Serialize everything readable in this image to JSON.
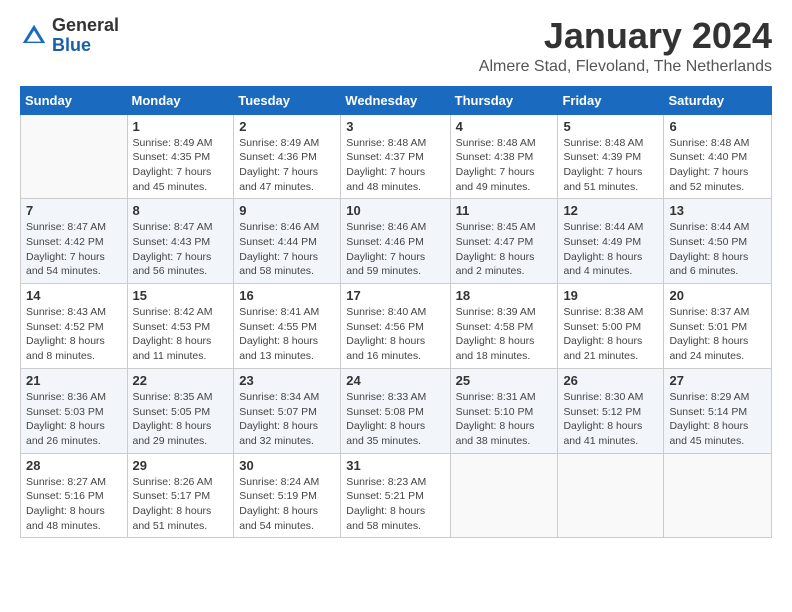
{
  "header": {
    "logo_general": "General",
    "logo_blue": "Blue",
    "month": "January 2024",
    "location": "Almere Stad, Flevoland, The Netherlands"
  },
  "days_of_week": [
    "Sunday",
    "Monday",
    "Tuesday",
    "Wednesday",
    "Thursday",
    "Friday",
    "Saturday"
  ],
  "weeks": [
    [
      {
        "day": "",
        "info": ""
      },
      {
        "day": "1",
        "info": "Sunrise: 8:49 AM\nSunset: 4:35 PM\nDaylight: 7 hours\nand 45 minutes."
      },
      {
        "day": "2",
        "info": "Sunrise: 8:49 AM\nSunset: 4:36 PM\nDaylight: 7 hours\nand 47 minutes."
      },
      {
        "day": "3",
        "info": "Sunrise: 8:48 AM\nSunset: 4:37 PM\nDaylight: 7 hours\nand 48 minutes."
      },
      {
        "day": "4",
        "info": "Sunrise: 8:48 AM\nSunset: 4:38 PM\nDaylight: 7 hours\nand 49 minutes."
      },
      {
        "day": "5",
        "info": "Sunrise: 8:48 AM\nSunset: 4:39 PM\nDaylight: 7 hours\nand 51 minutes."
      },
      {
        "day": "6",
        "info": "Sunrise: 8:48 AM\nSunset: 4:40 PM\nDaylight: 7 hours\nand 52 minutes."
      }
    ],
    [
      {
        "day": "7",
        "info": "Sunrise: 8:47 AM\nSunset: 4:42 PM\nDaylight: 7 hours\nand 54 minutes."
      },
      {
        "day": "8",
        "info": "Sunrise: 8:47 AM\nSunset: 4:43 PM\nDaylight: 7 hours\nand 56 minutes."
      },
      {
        "day": "9",
        "info": "Sunrise: 8:46 AM\nSunset: 4:44 PM\nDaylight: 7 hours\nand 58 minutes."
      },
      {
        "day": "10",
        "info": "Sunrise: 8:46 AM\nSunset: 4:46 PM\nDaylight: 7 hours\nand 59 minutes."
      },
      {
        "day": "11",
        "info": "Sunrise: 8:45 AM\nSunset: 4:47 PM\nDaylight: 8 hours\nand 2 minutes."
      },
      {
        "day": "12",
        "info": "Sunrise: 8:44 AM\nSunset: 4:49 PM\nDaylight: 8 hours\nand 4 minutes."
      },
      {
        "day": "13",
        "info": "Sunrise: 8:44 AM\nSunset: 4:50 PM\nDaylight: 8 hours\nand 6 minutes."
      }
    ],
    [
      {
        "day": "14",
        "info": "Sunrise: 8:43 AM\nSunset: 4:52 PM\nDaylight: 8 hours\nand 8 minutes."
      },
      {
        "day": "15",
        "info": "Sunrise: 8:42 AM\nSunset: 4:53 PM\nDaylight: 8 hours\nand 11 minutes."
      },
      {
        "day": "16",
        "info": "Sunrise: 8:41 AM\nSunset: 4:55 PM\nDaylight: 8 hours\nand 13 minutes."
      },
      {
        "day": "17",
        "info": "Sunrise: 8:40 AM\nSunset: 4:56 PM\nDaylight: 8 hours\nand 16 minutes."
      },
      {
        "day": "18",
        "info": "Sunrise: 8:39 AM\nSunset: 4:58 PM\nDaylight: 8 hours\nand 18 minutes."
      },
      {
        "day": "19",
        "info": "Sunrise: 8:38 AM\nSunset: 5:00 PM\nDaylight: 8 hours\nand 21 minutes."
      },
      {
        "day": "20",
        "info": "Sunrise: 8:37 AM\nSunset: 5:01 PM\nDaylight: 8 hours\nand 24 minutes."
      }
    ],
    [
      {
        "day": "21",
        "info": "Sunrise: 8:36 AM\nSunset: 5:03 PM\nDaylight: 8 hours\nand 26 minutes."
      },
      {
        "day": "22",
        "info": "Sunrise: 8:35 AM\nSunset: 5:05 PM\nDaylight: 8 hours\nand 29 minutes."
      },
      {
        "day": "23",
        "info": "Sunrise: 8:34 AM\nSunset: 5:07 PM\nDaylight: 8 hours\nand 32 minutes."
      },
      {
        "day": "24",
        "info": "Sunrise: 8:33 AM\nSunset: 5:08 PM\nDaylight: 8 hours\nand 35 minutes."
      },
      {
        "day": "25",
        "info": "Sunrise: 8:31 AM\nSunset: 5:10 PM\nDaylight: 8 hours\nand 38 minutes."
      },
      {
        "day": "26",
        "info": "Sunrise: 8:30 AM\nSunset: 5:12 PM\nDaylight: 8 hours\nand 41 minutes."
      },
      {
        "day": "27",
        "info": "Sunrise: 8:29 AM\nSunset: 5:14 PM\nDaylight: 8 hours\nand 45 minutes."
      }
    ],
    [
      {
        "day": "28",
        "info": "Sunrise: 8:27 AM\nSunset: 5:16 PM\nDaylight: 8 hours\nand 48 minutes."
      },
      {
        "day": "29",
        "info": "Sunrise: 8:26 AM\nSunset: 5:17 PM\nDaylight: 8 hours\nand 51 minutes."
      },
      {
        "day": "30",
        "info": "Sunrise: 8:24 AM\nSunset: 5:19 PM\nDaylight: 8 hours\nand 54 minutes."
      },
      {
        "day": "31",
        "info": "Sunrise: 8:23 AM\nSunset: 5:21 PM\nDaylight: 8 hours\nand 58 minutes."
      },
      {
        "day": "",
        "info": ""
      },
      {
        "day": "",
        "info": ""
      },
      {
        "day": "",
        "info": ""
      }
    ]
  ]
}
